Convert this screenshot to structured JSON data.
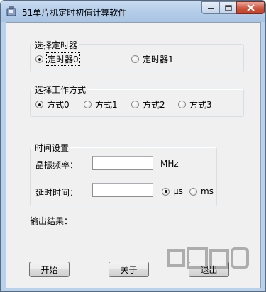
{
  "window": {
    "title": "51单片机定时初值计算软件"
  },
  "timer_group": {
    "label": "选择定时器",
    "options": [
      {
        "label": "定时器0",
        "selected": true
      },
      {
        "label": "定时器1",
        "selected": false
      }
    ]
  },
  "mode_group": {
    "label": "选择工作方式",
    "options": [
      {
        "label": "方式0",
        "selected": true
      },
      {
        "label": "方式1",
        "selected": false
      },
      {
        "label": "方式2",
        "selected": false
      },
      {
        "label": "方式3",
        "selected": false
      }
    ]
  },
  "time_group": {
    "label": "时间设置",
    "crystal_label": "晶振频率：",
    "crystal_value": "",
    "crystal_unit": "MHz",
    "delay_label": "延时时间：",
    "delay_value": "",
    "unit_options": [
      {
        "label": "μs",
        "selected": true
      },
      {
        "label": "ms",
        "selected": false
      }
    ]
  },
  "result": {
    "label": "输出结果："
  },
  "buttons": {
    "start": "开始",
    "about": "关于",
    "exit": "退出"
  },
  "icons": {
    "app": "app-icon",
    "minimize": "minimize-icon",
    "maximize": "maximize-icon",
    "close": "close-icon"
  }
}
